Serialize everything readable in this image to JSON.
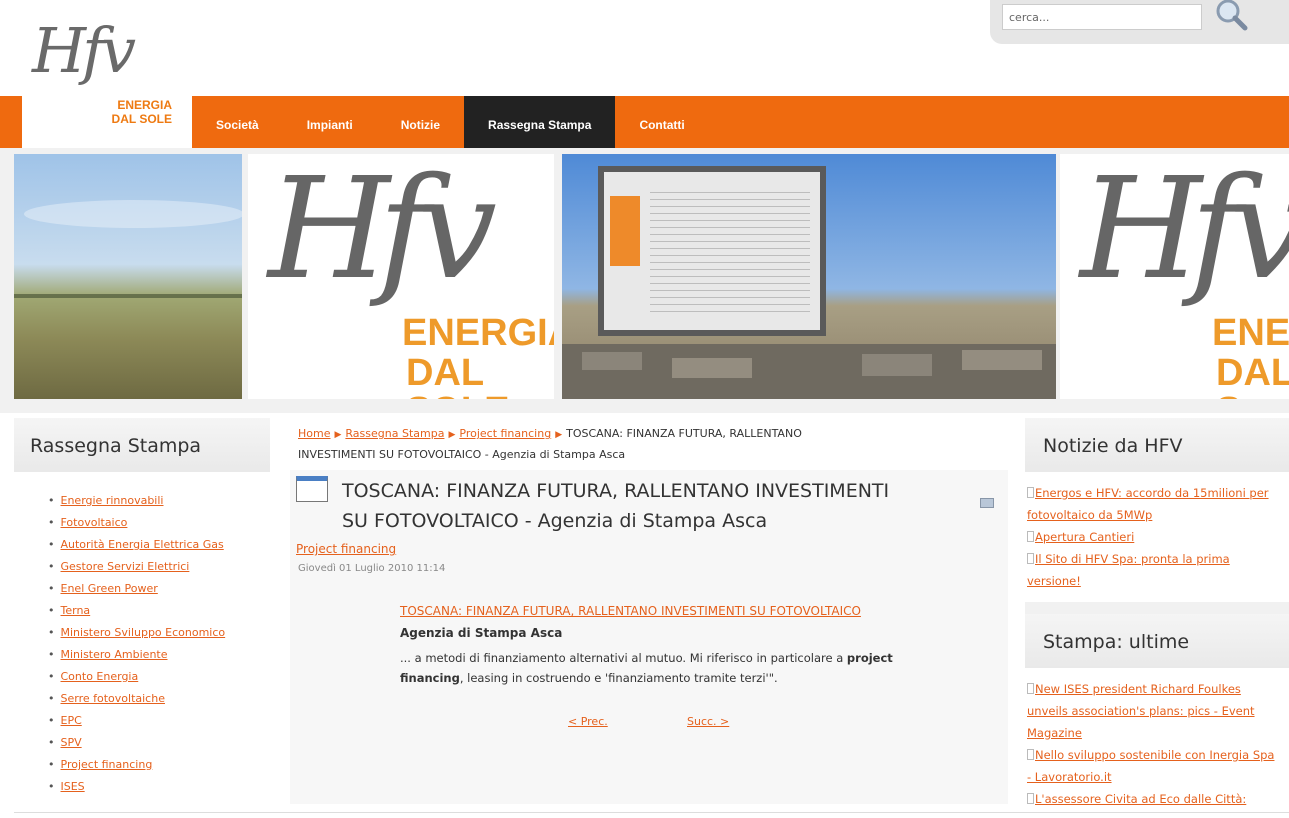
{
  "header": {
    "logo_mark": "Hfv",
    "logo_line1": "ENERGIA",
    "logo_line2": "DAL SOLE",
    "search_placeholder": "cerca..."
  },
  "nav": {
    "items": [
      {
        "label": "Società"
      },
      {
        "label": "Impianti"
      },
      {
        "label": "Notizie"
      },
      {
        "label": "Rassegna Stampa",
        "active": true
      },
      {
        "label": "Contatti"
      }
    ]
  },
  "banner": {
    "mark": "Hfv",
    "line1": "ENERGIA",
    "line2": "DAL SOLE",
    "line1_cut": "ENEF",
    "line2_cut": "DAL S"
  },
  "left_sidebar": {
    "title": "Rassegna Stampa",
    "items": [
      "Energie rinnovabili",
      "Fotovoltaico",
      "Autorità Energia Elettrica Gas",
      "Gestore Servizi Elettrici",
      "Enel Green Power",
      "Terna",
      "Ministero Sviluppo Economico",
      "Ministero Ambiente",
      "Conto Energia",
      "Serre fotovoltaiche",
      "EPC",
      "SPV",
      "Project financing",
      "ISES"
    ]
  },
  "breadcrumb": {
    "home": "Home",
    "section": "Rassegna Stampa",
    "category": "Project financing",
    "current_line1": "TOSCANA: FINANZA FUTURA, RALLENTANO",
    "current_line2": "INVESTIMENTI SU FOTOVOLTAICO - Agenzia di Stampa Asca"
  },
  "article": {
    "title_line1": "TOSCANA: FINANZA FUTURA, RALLENTANO INVESTIMENTI",
    "title_line2": "SU FOTOVOLTAICO - Agenzia di Stampa Asca",
    "category": "Project financing",
    "date": "Giovedì 01 Luglio 2010 11:14",
    "link_title": "TOSCANA: FINANZA FUTURA, RALLENTANO INVESTIMENTI SU FOTOVOLTAICO",
    "source": "Agenzia di Stampa Asca",
    "excerpt_a": "... a metodi di finanziamento alternativi al mutuo. Mi riferisco in particolare a ",
    "excerpt_b1": "project",
    "excerpt_b2": "financing",
    "excerpt_c": ", leasing in costruendo e 'finanziamento tramite terzi'\".",
    "prev": "< Prec.",
    "next": "Succ. >"
  },
  "right_sidebar": {
    "news_title": "Notizie da HFV",
    "news": [
      "Energos e HFV: accordo da 15milioni per fotovoltaico da 5MWp",
      "Apertura Cantieri",
      "Il Sito di HFV Spa: pronta la prima versione!"
    ],
    "press_title": "Stampa: ultime",
    "press": [
      "New ISES president Richard Foulkes unveils association's plans: pics - Event Magazine",
      "Nello sviluppo sostenibile con Inergia Spa - Lavoratorio.it",
      "L'assessore Civita ad Eco dalle Città:"
    ]
  },
  "colors": {
    "accent": "#ef6a0f",
    "link": "#e5611d",
    "nav_active": "#222222"
  }
}
